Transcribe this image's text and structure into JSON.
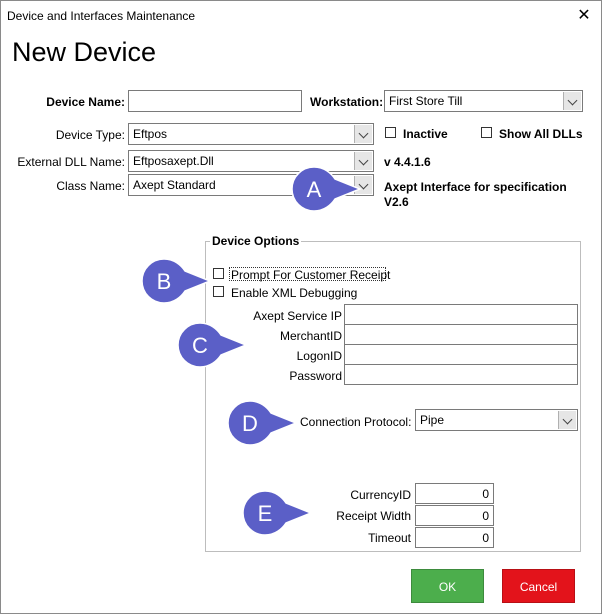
{
  "window": {
    "title": "Device and Interfaces Maintenance",
    "close_glyph": "✕"
  },
  "heading": "New Device",
  "form": {
    "device_name_label": "Device Name:",
    "device_name_value": "",
    "workstation_label": "Workstation:",
    "workstation_value": "First Store Till",
    "device_type_label": "Device Type:",
    "device_type_value": "Eftpos",
    "inactive_label": "Inactive",
    "inactive_checked": false,
    "show_all_dlls_label": "Show All DLLs",
    "show_all_dlls_checked": false,
    "external_dll_label": "External DLL Name:",
    "external_dll_value": "Eftposaxept.Dll",
    "dll_version": "v 4.4.1.6",
    "class_name_label": "Class Name:",
    "class_name_value": "Axept Standard",
    "class_description": "Axept Interface for specification V2.6"
  },
  "device_options": {
    "legend": "Device Options",
    "prompt_receipt_label": "Prompt For Customer Receipt",
    "prompt_receipt_checked": false,
    "xml_debug_label": "Enable XML Debugging",
    "xml_debug_checked": false,
    "service_ip_label": "Axept Service IP",
    "service_ip_value": "",
    "merchant_id_label": "MerchantID",
    "merchant_id_value": "",
    "logon_id_label": "LogonID",
    "logon_id_value": "",
    "password_label": "Password",
    "password_value": "",
    "connection_protocol_label": "Connection Protocol:",
    "connection_protocol_value": "Pipe",
    "currency_id_label": "CurrencyID",
    "currency_id_value": "0",
    "receipt_width_label": "Receipt Width",
    "receipt_width_value": "0",
    "timeout_label": "Timeout",
    "timeout_value": "0"
  },
  "callouts": {
    "a": "A",
    "b": "B",
    "c": "C",
    "d": "D",
    "e": "E",
    "color": "#5b5fc7"
  },
  "buttons": {
    "ok": "OK",
    "cancel": "Cancel",
    "ok_color": "#4cae4c",
    "cancel_color": "#e3131b"
  },
  "icons": {
    "dropdown": "chevron-down-icon",
    "close": "close-icon"
  }
}
